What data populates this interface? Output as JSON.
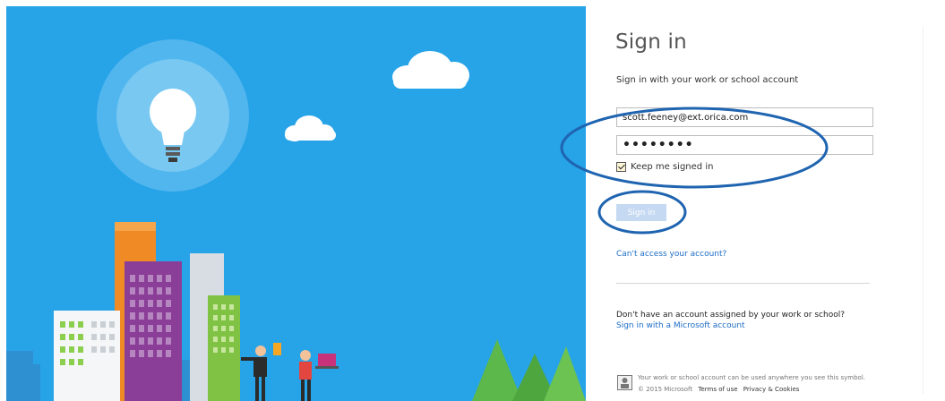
{
  "signin": {
    "title": "Sign in",
    "subtitle": "Sign in with your work or school account",
    "email_value": "scott.feeney@ext.orica.com",
    "password_value": "••••••••",
    "keep_signed_in_label": "Keep me signed in",
    "keep_signed_in_checked": true,
    "signin_button_label": "Sign in",
    "cant_access_link": "Can't access your account?",
    "no_account_text": "Don't have an account assigned by your work or school?",
    "microsoft_account_link": "Sign in with a Microsoft account"
  },
  "footer": {
    "notice": "Your work or school account can be used anywhere you see this symbol.",
    "copyright": "© 2015 Microsoft",
    "terms_link": "Terms of use",
    "privacy_link": "Privacy & Cookies"
  },
  "colors": {
    "illustration_background": "#27a3e8",
    "link": "#1d6dc6",
    "signin_button": "#c6d9f2",
    "annotation_ring": "#1f64b0"
  },
  "icons": {
    "illustration": "lightbulb-city-illustration",
    "footer_symbol": "work-account-icon"
  }
}
